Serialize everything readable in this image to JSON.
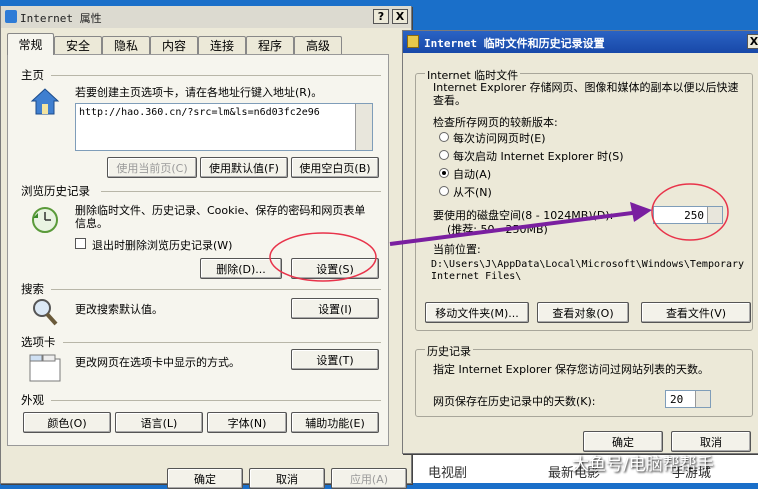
{
  "desktop": {
    "bg_color": "#1a6fc9"
  },
  "left": {
    "title": "Internet 属性",
    "help_btn": "?",
    "close_btn": "X",
    "tabs": [
      "常规",
      "安全",
      "隐私",
      "内容",
      "连接",
      "程序",
      "高级"
    ],
    "home": {
      "section": "主页",
      "desc": "若要创建主页选项卡，请在各地址行键入地址(R)。",
      "url": "http://hao.360.cn/?src=lm&ls=n6d03fc2e96",
      "btn_current": "使用当前页(C)",
      "btn_default": "使用默认值(F)",
      "btn_blank": "使用空白页(B)"
    },
    "history": {
      "section": "浏览历史记录",
      "desc": "删除临时文件、历史记录、Cookie、保存的密码和网页表单信息。",
      "check_label": "退出时删除浏览历史记录(W)",
      "btn_delete": "删除(D)...",
      "btn_settings": "设置(S)"
    },
    "search": {
      "section": "搜索",
      "desc": "更改搜索默认值。",
      "btn_settings": "设置(I)"
    },
    "tabs_section": {
      "section": "选项卡",
      "desc": "更改网页在选项卡中显示的方式。",
      "btn_settings": "设置(T)"
    },
    "appearance": {
      "section": "外观",
      "btn_colors": "颜色(O)",
      "btn_languages": "语言(L)",
      "btn_fonts": "字体(N)",
      "btn_accessibility": "辅助功能(E)"
    },
    "footer": {
      "ok": "确定",
      "cancel": "取消",
      "apply": "应用(A)"
    }
  },
  "right": {
    "title": "Internet 临时文件和历史记录设置",
    "close_btn": "X",
    "temp": {
      "group": "Internet 临时文件",
      "desc": "Internet Explorer 存储网页、图像和媒体的副本以便以后快速查看。",
      "check_label": "检查所存网页的较新版本:",
      "options": [
        "每次访问网页时(E)",
        "每次启动 Internet Explorer 时(S)",
        "自动(A)",
        "从不(N)"
      ],
      "selected": "自动(A)",
      "disk_label": "要使用的磁盘空间(8 - 1024MB)(D):",
      "disk_hint": "(推荐: 50 - 250MB)",
      "disk_value": "250",
      "location_label": "当前位置:",
      "location_path": "D:\\Users\\J\\AppData\\Local\\Microsoft\\Windows\\Temporary Internet Files\\",
      "btn_move": "移动文件夹(M)...",
      "btn_objects": "查看对象(O)",
      "btn_files": "查看文件(V)"
    },
    "history": {
      "group": "历史记录",
      "desc": "指定 Internet Explorer 保存您访问过网站列表的天数。",
      "days_label": "网页保存在历史记录中的天数(K):",
      "days_value": "20"
    },
    "footer": {
      "ok": "确定",
      "cancel": "取消"
    }
  },
  "background_text": {
    "item1": "电视剧",
    "item2": "最新电影",
    "item3": "手游城"
  },
  "watermark": "大鱼号/电脑帮帮手",
  "accent": {
    "annotation": "#e8334a",
    "arrow": "#7a1fa0"
  }
}
